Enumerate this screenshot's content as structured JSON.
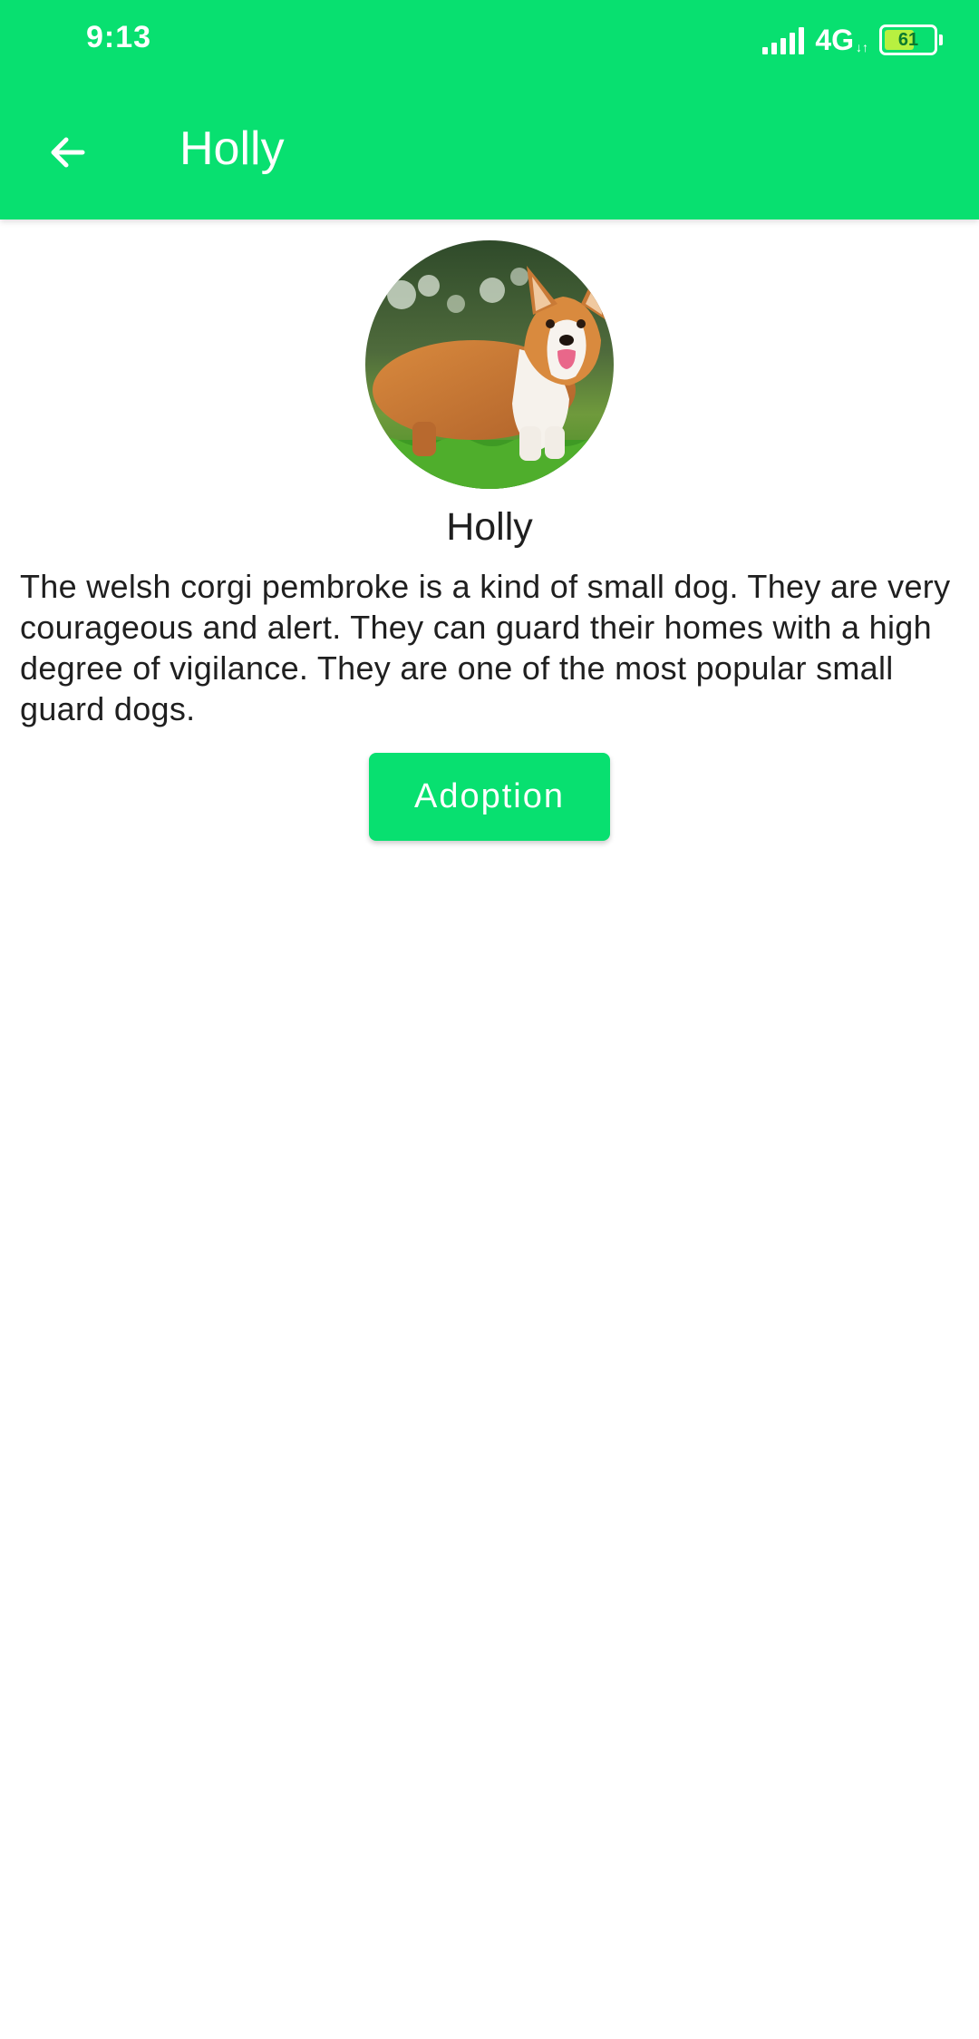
{
  "colors": {
    "primary": "#08e070",
    "on_primary": "#ffffff",
    "text": "#1f1f1f",
    "background": "#ffffff"
  },
  "status_bar": {
    "time": "9:13",
    "network": "4G",
    "network_activity": "↓↑",
    "battery": "61",
    "battery_level": 0.61,
    "signal_icon": "signal-bars-icon"
  },
  "app_bar": {
    "back_icon": "arrow-back-icon",
    "title": "Holly"
  },
  "pet": {
    "photo_icon": "corgi-photo",
    "name": "Holly",
    "description": "The welsh corgi pembroke is a kind of small dog. They are very courageous and alert. They can guard their homes with a high degree of vigilance. They are one of the most popular small guard dogs."
  },
  "actions": {
    "adopt_label": "Adoption"
  }
}
